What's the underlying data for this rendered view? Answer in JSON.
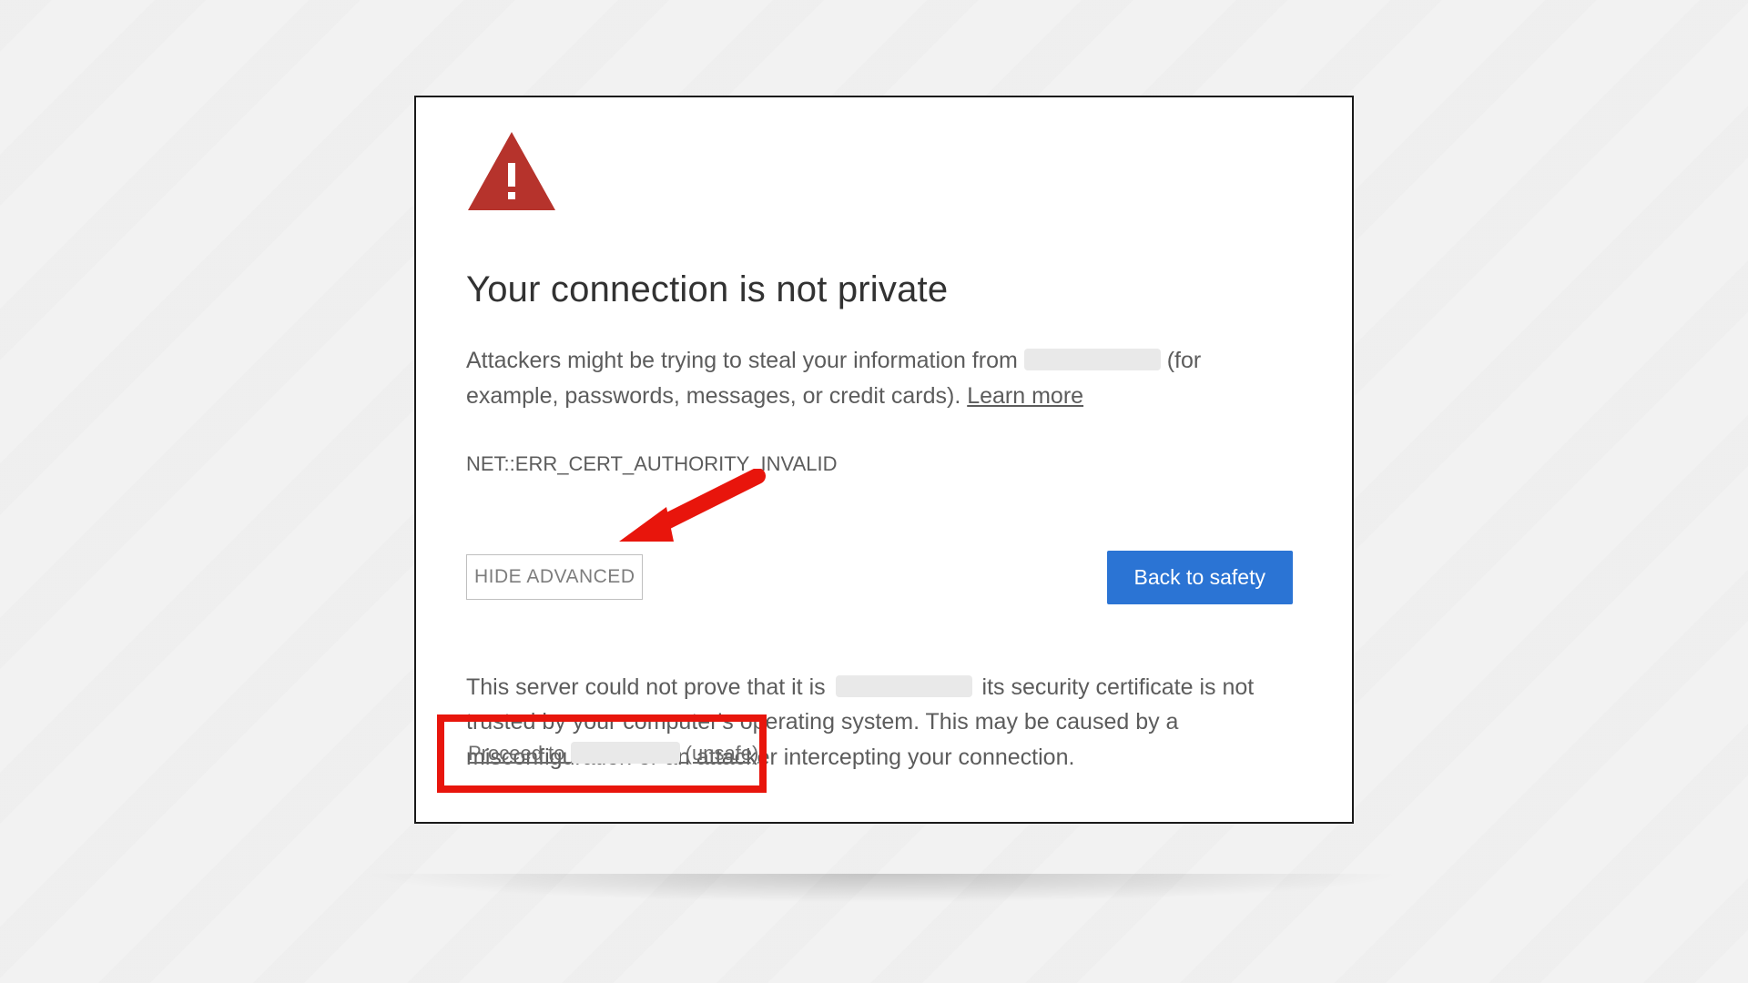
{
  "title": "Your connection is not private",
  "desc_part1": "Attackers might be trying to steal your information from ",
  "desc_part2": "(for example, passwords, messages, or credit cards). ",
  "learn_more_label": "Learn more",
  "error_code": "NET::ERR_CERT_AUTHORITY_INVALID",
  "hide_advanced_label": "HIDE ADVANCED",
  "back_to_safety_label": "Back to safety",
  "advanced_part1": "This server could not prove that it is ",
  "advanced_part2": " its security certificate is not trusted by your computer's operating system. This may be caused by a misconfiguration or an attacker intercepting your connection.",
  "proceed_label_prefix": "Proceed to ",
  "proceed_label_suffix": "(unsafe)",
  "colors": {
    "danger": "#b6332c",
    "primary": "#2b74d4",
    "highlight": "#e8150c"
  }
}
